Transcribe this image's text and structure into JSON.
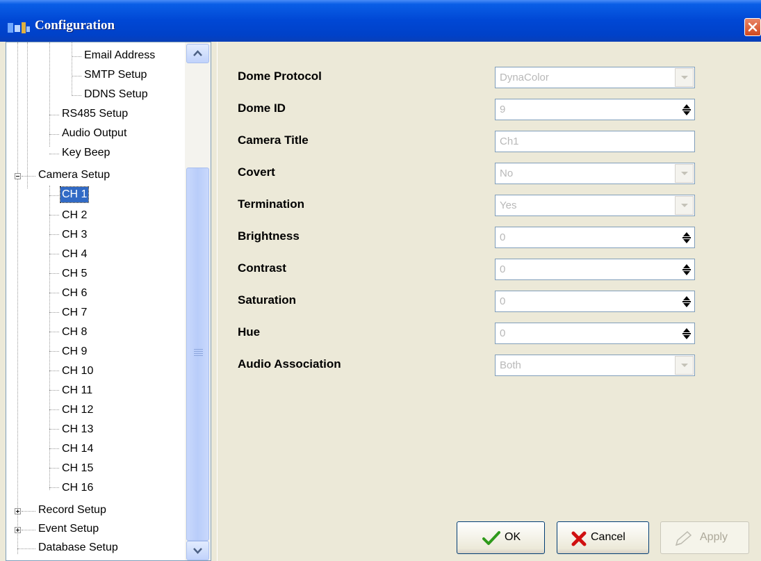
{
  "window": {
    "title": "Configuration",
    "icons": {
      "app": "app-icon",
      "close": "close-icon"
    }
  },
  "tree": {
    "items": [
      {
        "label": "Email Address"
      },
      {
        "label": "SMTP Setup"
      },
      {
        "label": "DDNS Setup"
      },
      {
        "label": "RS485 Setup"
      },
      {
        "label": "Audio Output"
      },
      {
        "label": "Key Beep"
      },
      {
        "label": "Camera Setup"
      },
      {
        "label": "CH 1"
      },
      {
        "label": "CH 2"
      },
      {
        "label": "CH 3"
      },
      {
        "label": "CH 4"
      },
      {
        "label": "CH 5"
      },
      {
        "label": "CH 6"
      },
      {
        "label": "CH 7"
      },
      {
        "label": "CH 8"
      },
      {
        "label": "CH 9"
      },
      {
        "label": "CH 10"
      },
      {
        "label": "CH 11"
      },
      {
        "label": "CH 12"
      },
      {
        "label": "CH 13"
      },
      {
        "label": "CH 14"
      },
      {
        "label": "CH 15"
      },
      {
        "label": "CH 16"
      },
      {
        "label": "Record Setup"
      },
      {
        "label": "Event Setup"
      },
      {
        "label": "Database Setup"
      }
    ],
    "selected": "CH 1"
  },
  "form": {
    "fields": [
      {
        "label": "Dome Protocol",
        "value": "DynaColor",
        "control": "dropdown"
      },
      {
        "label": "Dome ID",
        "value": "9",
        "control": "spinner"
      },
      {
        "label": "Camera Title",
        "value": "Ch1",
        "control": "text"
      },
      {
        "label": "Covert",
        "value": "No",
        "control": "dropdown"
      },
      {
        "label": "Termination",
        "value": "Yes",
        "control": "dropdown"
      },
      {
        "label": "Brightness",
        "value": "0",
        "control": "spinner"
      },
      {
        "label": "Contrast",
        "value": "0",
        "control": "spinner"
      },
      {
        "label": "Saturation",
        "value": "0",
        "control": "spinner"
      },
      {
        "label": "Hue",
        "value": "0",
        "control": "spinner"
      },
      {
        "label": "Audio Association",
        "value": "Both",
        "control": "dropdown"
      }
    ]
  },
  "buttons": {
    "ok": "OK",
    "cancel": "Cancel",
    "apply": "Apply",
    "icons": {
      "ok": "checkmark-icon",
      "cancel": "x-icon",
      "apply": "pencil-icon"
    }
  },
  "colors": {
    "titlebar": "#0047d4",
    "selection": "#316ac5",
    "ok_check": "#2f9a1b",
    "cancel_x": "#d01010"
  }
}
